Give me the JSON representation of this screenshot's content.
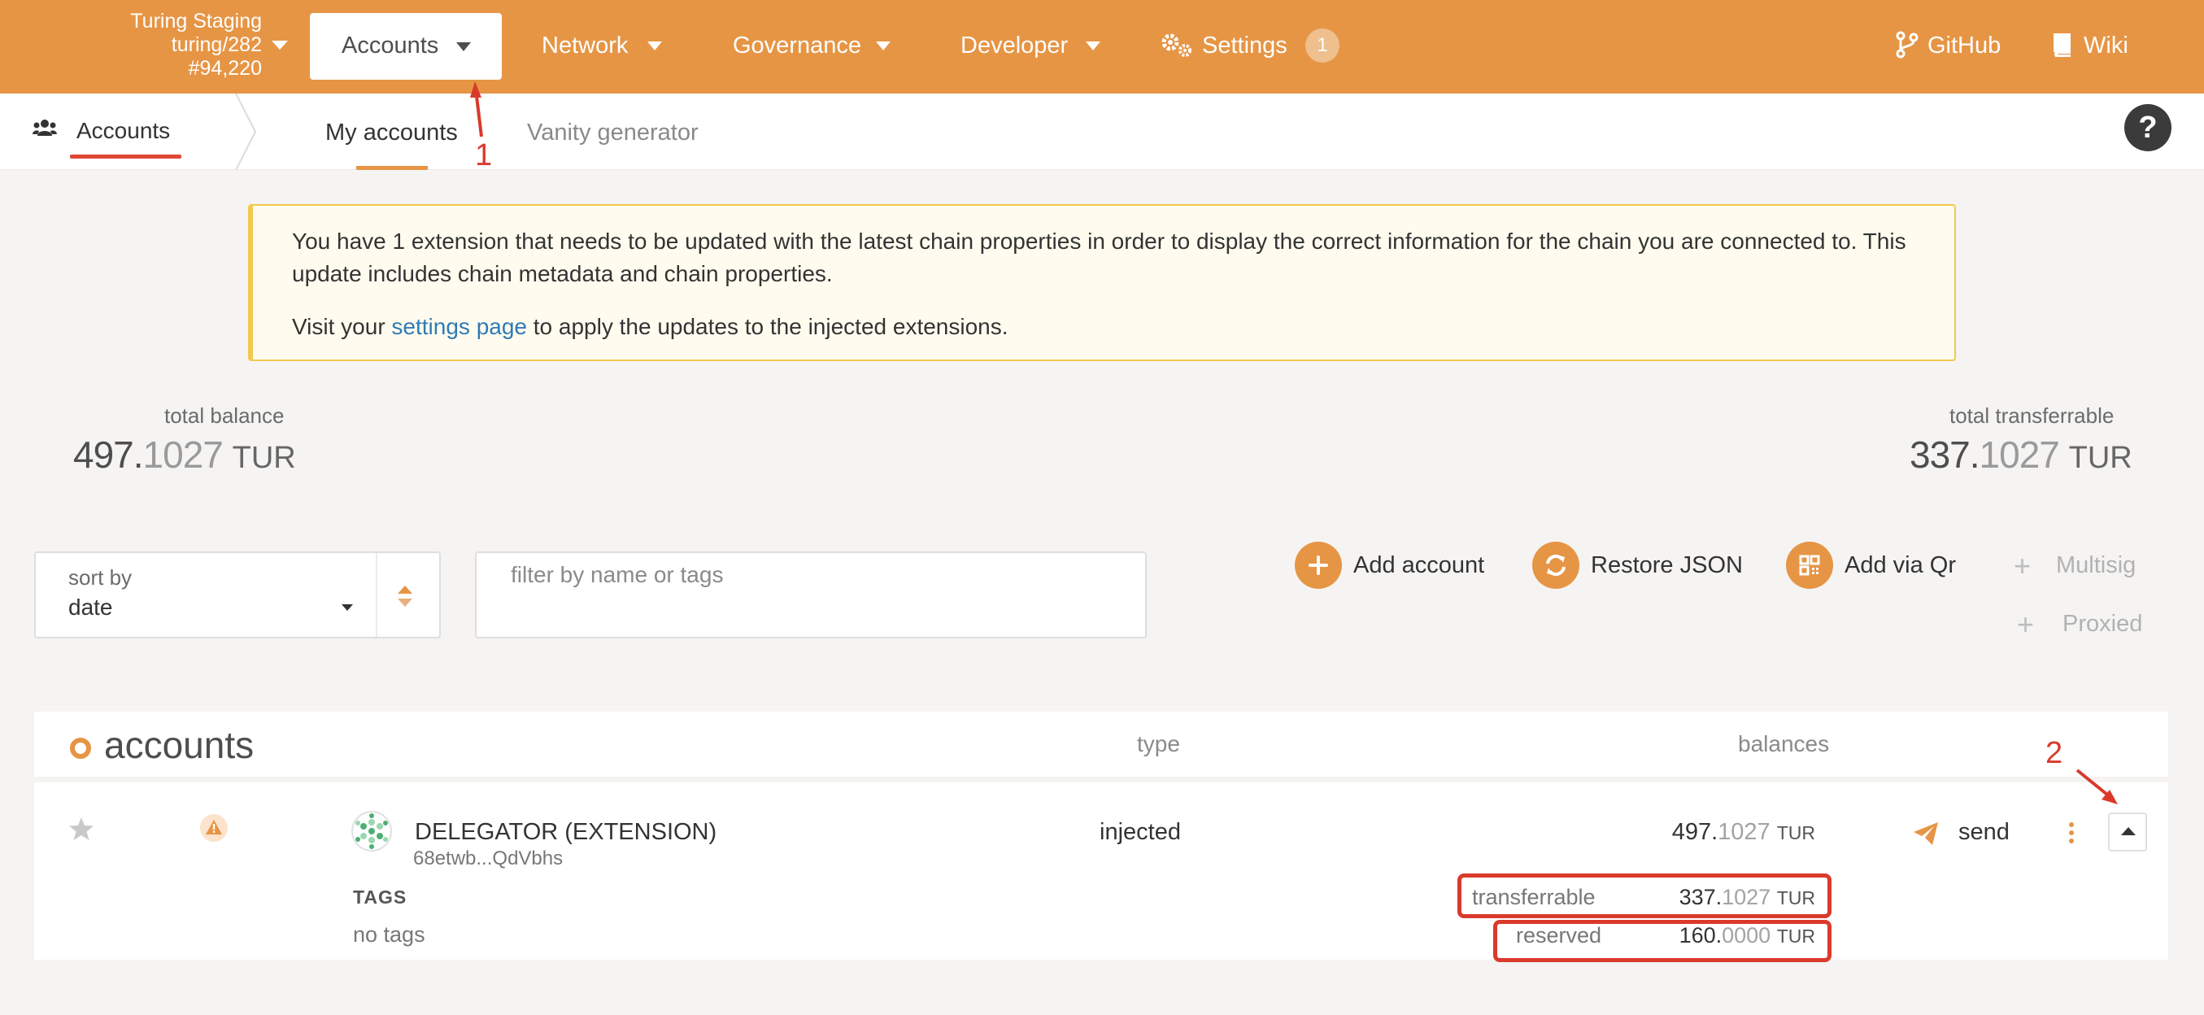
{
  "chain": {
    "name": "Turing Staging",
    "version": "turing/282",
    "block": "#94,220"
  },
  "nav": {
    "accounts": "Accounts",
    "network": "Network",
    "governance": "Governance",
    "developer": "Developer",
    "settings": "Settings",
    "settings_badge": "1",
    "github": "GitHub",
    "wiki": "Wiki"
  },
  "subnav": {
    "section": "Accounts",
    "tabs": [
      "My accounts",
      "Vanity generator"
    ],
    "help": "?"
  },
  "banner": {
    "line1": "You have 1 extension that needs to be updated with the latest chain properties in order to display the correct information for the chain you are connected to. This update includes chain metadata and chain properties.",
    "line2_prefix": "Visit your ",
    "line2_link": "settings page",
    "line2_suffix": " to apply the updates to the injected extensions."
  },
  "summary": {
    "total_balance_label": "total balance",
    "total_balance_int": "497.",
    "total_balance_dec": "1027",
    "total_transferrable_label": "total transferrable",
    "total_transferrable_int": "337.",
    "total_transferrable_dec": "1027",
    "unit": "TUR"
  },
  "controls": {
    "sort_label": "sort by",
    "sort_value": "date",
    "filter_placeholder": "filter by name or tags",
    "add_account": "Add account",
    "restore_json": "Restore JSON",
    "add_via_qr": "Add via Qr",
    "multisig": "Multisig",
    "proxied": "Proxied"
  },
  "table": {
    "title": "accounts",
    "col_type": "type",
    "col_balances": "balances",
    "rows": [
      {
        "name": "DELEGATOR (EXTENSION)",
        "address": "68etwb...QdVbhs",
        "type": "injected",
        "balance_int": "497.",
        "balance_dec": "1027",
        "unit": "TUR",
        "send": "send",
        "tags_label": "TAGS",
        "tags": "no tags",
        "transferrable_label": "transferrable",
        "transferrable_int": "337.",
        "transferrable_dec": "1027",
        "reserved_label": "reserved",
        "reserved_int": "160.",
        "reserved_dec": "0000"
      }
    ]
  },
  "annotations": {
    "marker1": "1",
    "marker2": "2"
  },
  "colors": {
    "brand": "#e69545",
    "annotation": "#d93a2c",
    "link": "#2f7ab5",
    "warning_border": "#f2c94c"
  }
}
